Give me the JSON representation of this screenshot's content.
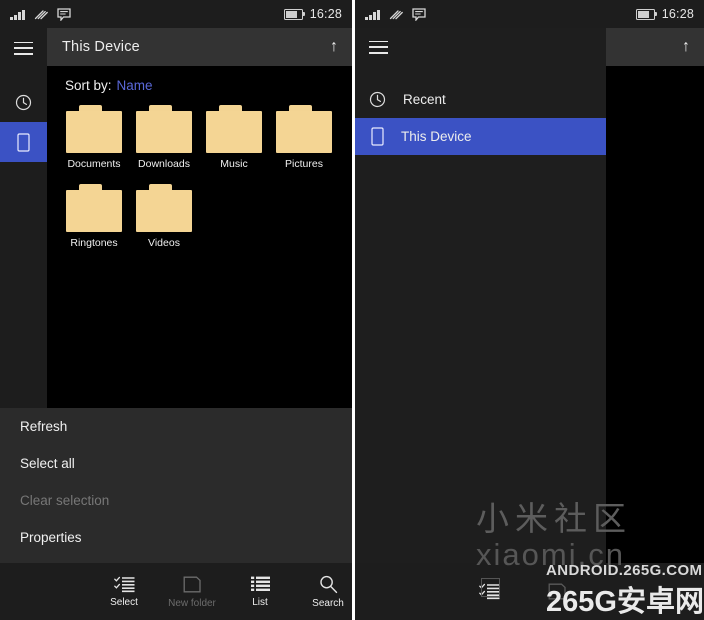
{
  "status_bar": {
    "signal_icon": "signal-bars-icon",
    "wifi_icon": "wifi-icon",
    "message_icon": "message-icon",
    "battery_icon": "battery-icon",
    "time": "16:28"
  },
  "left_screen": {
    "rail": {
      "menu_icon": "hamburger-menu-icon",
      "items": [
        {
          "icon": "clock-icon",
          "name": "recent",
          "selected": false
        },
        {
          "icon": "phone-icon",
          "name": "this-device",
          "selected": true
        }
      ]
    },
    "top_bar": {
      "title": "This Device",
      "up_icon": "arrow-up-icon"
    },
    "sort": {
      "label": "Sort by:",
      "value": "Name"
    },
    "folders": [
      {
        "name": "Documents",
        "icon": "folder-icon"
      },
      {
        "name": "Downloads",
        "icon": "folder-icon"
      },
      {
        "name": "Music",
        "icon": "folder-icon"
      },
      {
        "name": "Pictures",
        "icon": "folder-icon"
      },
      {
        "name": "Ringtones",
        "icon": "folder-icon"
      },
      {
        "name": "Videos",
        "icon": "folder-icon"
      }
    ],
    "context_menu": [
      {
        "label": "Refresh",
        "disabled": false
      },
      {
        "label": "Select all",
        "disabled": false
      },
      {
        "label": "Clear selection",
        "disabled": true
      },
      {
        "label": "Properties",
        "disabled": false
      }
    ],
    "app_bar": {
      "buttons": [
        {
          "label": "Select",
          "icon": "select-checklist-icon",
          "disabled": false
        },
        {
          "label": "New folder",
          "icon": "new-folder-icon",
          "disabled": true
        },
        {
          "label": "List",
          "icon": "list-view-icon",
          "disabled": false
        },
        {
          "label": "Search",
          "icon": "search-icon",
          "disabled": false
        }
      ],
      "more_icon": "more-ellipsis-icon"
    }
  },
  "right_screen": {
    "top_bar": {
      "up_icon": "arrow-up-icon"
    },
    "drawer": {
      "menu_icon": "hamburger-menu-icon",
      "items": [
        {
          "label": "Recent",
          "icon": "clock-icon",
          "selected": false
        },
        {
          "label": "This Device",
          "icon": "phone-icon",
          "selected": true
        }
      ]
    },
    "app_bar": {
      "buttons": [
        {
          "icon": "select-checklist-icon",
          "disabled": false
        },
        {
          "icon": "new-folder-icon",
          "disabled": true
        }
      ]
    }
  },
  "watermarks": {
    "xiaomi_cn_zh": "小米社区",
    "xiaomi_cn_en": "xiaomi.cn",
    "site_url": "ANDROID.265G.COM",
    "site_name": "265G安卓网"
  },
  "colors": {
    "accent_blue": "#3b52c4",
    "link_blue": "#5a68d8",
    "folder_yellow": "#f4d594",
    "chrome_dark": "#1d1d1d",
    "top_bar_gray": "#333333",
    "menu_gray": "#2b2b2b",
    "content_black": "#000000"
  }
}
